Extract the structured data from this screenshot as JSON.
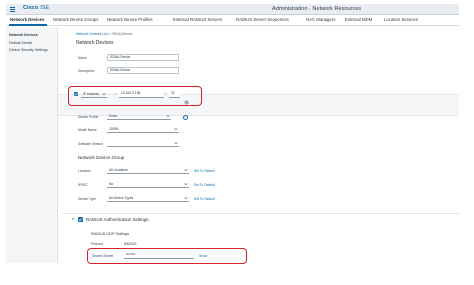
{
  "topbar": {
    "brand": "Cisco",
    "product": "ISE",
    "page_title": "Administration · Network Resources"
  },
  "nav": {
    "tabs": [
      {
        "label": "Network Devices",
        "active": true
      },
      {
        "label": "Network Device Groups"
      },
      {
        "label": "Network Device Profiles"
      },
      {
        "label": "External RADIUS Servers"
      },
      {
        "label": "RADIUS Server Sequences"
      },
      {
        "label": "NAC Managers"
      },
      {
        "label": "External MDM"
      },
      {
        "label": "Location Services"
      }
    ]
  },
  "sidebar": {
    "items": [
      {
        "label": "Network Devices",
        "active": true
      },
      {
        "label": "Default Device"
      },
      {
        "label": "Device Security Settings"
      }
    ]
  },
  "main": {
    "breadcrumb": {
      "parent": "Network Devices List",
      "sep": ">",
      "current": "SDNA-Device"
    },
    "title": "Network Devices",
    "name": {
      "label": "Name",
      "value": "SDNA-Device"
    },
    "description": {
      "label": "Description",
      "value": "SDNA-Device"
    },
    "ip": {
      "type": "IP Address",
      "sep": "*",
      "value": "10.150.0.138",
      "slash": "/",
      "mask": "32"
    },
    "device_profile": {
      "label": "Device Profile",
      "value": "Cisco"
    },
    "model_name": {
      "label": "Model Name",
      "value": "CBRN"
    },
    "software_version": {
      "label": "Software Version",
      "value": ""
    },
    "ndg_title": "Network Device Group",
    "location": {
      "label": "Location",
      "value": "All Locations",
      "action": "Set To Default"
    },
    "ipsec": {
      "label": "IPSEC",
      "value": "No",
      "action": "Set To Default"
    },
    "device_type": {
      "label": "Device Type",
      "value": "All Device Types",
      "action": "Set To Default"
    },
    "radius": {
      "title": "RADIUS Authentication Settings",
      "udp_title": "RADIUS UDP Settings",
      "protocol_label": "Protocol",
      "protocol_value": "RADIUS",
      "secret_label": "Shared Secret",
      "secret_value": "••••••••",
      "show_label": "Show"
    }
  },
  "colors": {
    "accent": "#0d6aa8",
    "highlight": "#d0262b"
  }
}
